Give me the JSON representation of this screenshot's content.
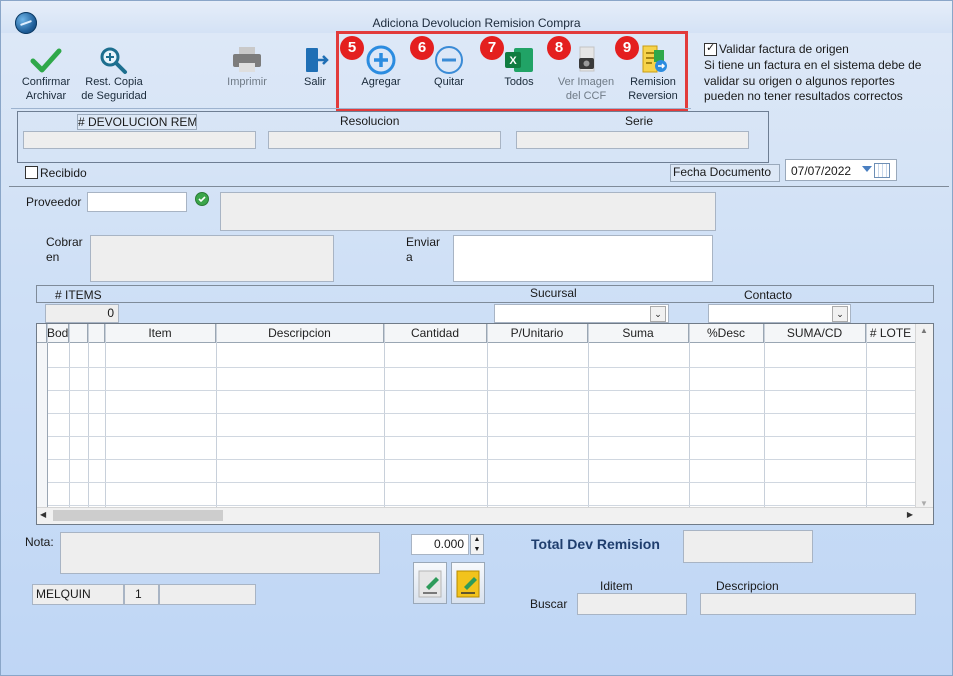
{
  "window": {
    "title": "Adiciona Devolucion Remision Compra"
  },
  "toolbar": {
    "confirmar": "Confirmar\nArchivar",
    "restcopia": "Rest. Copia\nde Seguridad",
    "imprimir": "Imprimir",
    "salir": "Salir",
    "agregar": "Agregar",
    "quitar": "Quitar",
    "todos": "Todos",
    "verimagen": "Ver Imagen\ndel CCF",
    "remision": "Remision\nReversion"
  },
  "badges": [
    "5",
    "6",
    "7",
    "8",
    "9"
  ],
  "validar": {
    "label": "Validar factura de origen",
    "checked": true,
    "note_lines": [
      "Si tiene un factura en el sistema debe de",
      "validar su origen o algunos reportes",
      "pueden no tener resultados correctos"
    ]
  },
  "doc_panel": {
    "devolucion_label": "# DEVOLUCION REMISION",
    "resolucion_label": "Resolucion",
    "serie_label": "Serie",
    "devolucion_value": "",
    "resolucion_value": "",
    "serie_value": ""
  },
  "recibido": {
    "label": "Recibido",
    "checked": false
  },
  "fecha": {
    "label": "Fecha Documento",
    "value": "07/07/2022"
  },
  "proveedor": {
    "label": "Proveedor",
    "code": "",
    "name": ""
  },
  "cobrar": {
    "label_lines": [
      "Cobrar",
      "en"
    ],
    "value": ""
  },
  "enviar": {
    "label_lines": [
      "Enviar",
      "a"
    ],
    "value": ""
  },
  "items_bar": {
    "items_label": "# ITEMS",
    "items_count": "0",
    "sucursal_label": "Sucursal",
    "contacto_label": "Contacto"
  },
  "grid": {
    "columns": [
      "Bodega",
      "Item",
      "Descripcion",
      "Cantidad",
      "P/Unitario",
      "Suma",
      "%Desc",
      "SUMA/CD",
      "# LOTE"
    ],
    "rows": []
  },
  "nota": {
    "label": "Nota:",
    "value": ""
  },
  "quantity": {
    "value": "0.000"
  },
  "total": {
    "label": "Total  Dev Remision",
    "value": ""
  },
  "status": {
    "user": "MELQUIN",
    "num": "1",
    "extra": ""
  },
  "buscar": {
    "label": "Buscar",
    "iditem_label": "Iditem",
    "descripcion_label": "Descripcion"
  },
  "colors": {
    "accent": "#e23b3b",
    "badge": "#e41f1f",
    "window_bg": "#cfe0f6"
  }
}
